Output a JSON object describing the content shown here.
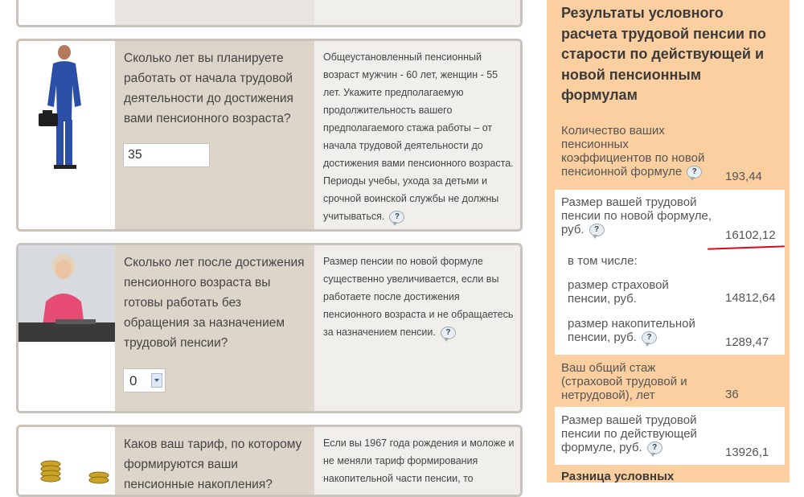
{
  "cards": [
    {
      "question": "Сколько лет вы планируете работать от начала трудовой деятельности до достижения вами пенсионного возраста?",
      "input_value": "35",
      "hint": "Общеустановленный пенсионный возраст мужчин - 60 лет, женщин - 55 лет. Укажите предполагаемую продолжительность вашего предполагаемого стажа работы – от начала трудовой деятельности до достижения вами пенсионного возраста. Периоды учебы, ухода за детьми и срочной воинской службы не должны учитываться."
    },
    {
      "question": "Сколько лет после достижения пенсионного возраста вы готовы работать без обращения за назначением трудовой пенсии?",
      "select_value": "0",
      "hint": "Размер пенсии по новой формуле существенно увеличивается, если вы работаете после достижения пенсионного возраста и не обращаетесь за назначением пенсии."
    },
    {
      "question": "Каков ваш тариф, по которому формируются ваши пенсионные накопления?",
      "hint": "Если вы 1967 года рождения и моложе и не меняли тариф формирования накопительной части пенсии, то"
    }
  ],
  "help_icon_text": "?",
  "results": {
    "title": "Результаты условного расчета трудовой пенсии по старости по действующей и новой пенсионным формулам",
    "coefficients_label": "Количество ваших пенсионных коэффициентов по новой пенсионной формуле",
    "coefficients_value": "193,44",
    "new_pension_label": "Размер вашей трудовой пенсии по новой формуле, руб.",
    "new_pension_value": "16102,12",
    "including_label": "в том числе:",
    "insurance_label": "размер страховой пенсии, руб.",
    "insurance_value": "14812,64",
    "funded_label": "размер накопительной пенсии, руб.",
    "funded_value": "1289,47",
    "experience_label": "Ваш общий стаж (страховой трудовой и нетрудовой), лет",
    "experience_value": "36",
    "current_pension_label": "Размер вашей трудовой пенсии по действующей формуле, руб.",
    "current_pension_value": "13926,1",
    "difference_label": "Разница условных"
  },
  "colors": {
    "card_border": "#c9c3bb",
    "card_question_bg": "#ddd5ca",
    "card_hint_bg": "#f1efec",
    "results_bg": "#fbcf9f",
    "underline_red": "#d8091b"
  },
  "icons": {
    "help": "speech-bubble-question-icon"
  }
}
